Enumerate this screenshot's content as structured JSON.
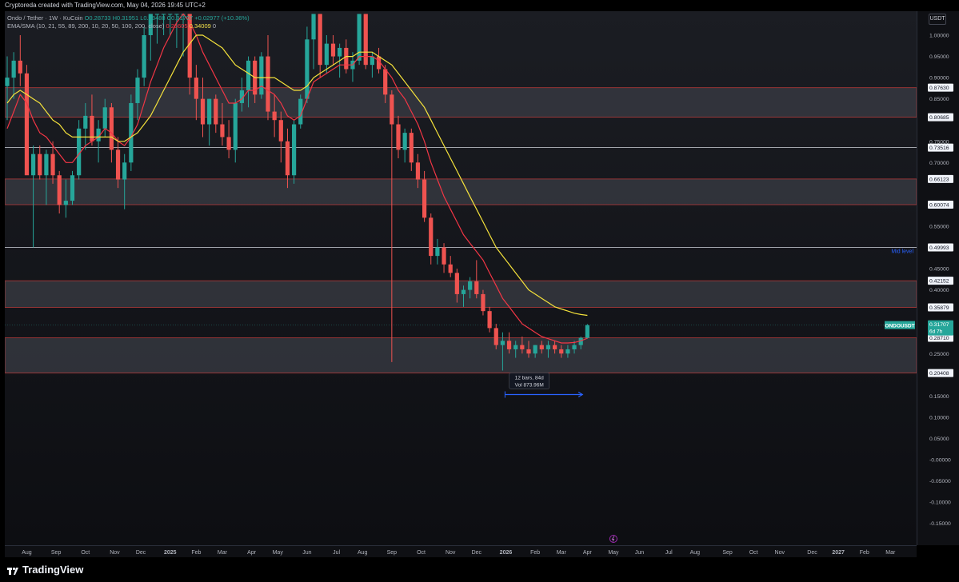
{
  "header": {
    "caption": "Cryptoreda created with TradingView.com, May 04, 2026 19:45 UTC+2"
  },
  "legend": {
    "symbol": "Ondo / Tether · 1W · KuCoin",
    "ohlc": "O0.28733  H0.31951  L0.28488  C0.31707  +0.02977 (+10.36%)",
    "indicator_name": "EMA/SMA (10, 21, 55, 89, 200, 10, 20, 50, 100, 200, close)",
    "ma_red_value": "0.28605",
    "ma_yellow_value": "0.34009",
    "tail": "0"
  },
  "price_axis": {
    "unit_button": "USDT",
    "ticks": [
      {
        "price": 1.0,
        "label": "1.00000"
      },
      {
        "price": 0.95,
        "label": "0.95000"
      },
      {
        "price": 0.9,
        "label": "0.90000"
      },
      {
        "price": 0.85,
        "label": "0.85000"
      },
      {
        "price": 0.75,
        "label": "0.75000"
      },
      {
        "price": 0.7,
        "label": "0.70000"
      },
      {
        "price": 0.55,
        "label": "0.55000"
      },
      {
        "price": 0.45,
        "label": "0.45000"
      },
      {
        "price": 0.4,
        "label": "0.40000"
      },
      {
        "price": 0.25,
        "label": "0.25000"
      },
      {
        "price": 0.15,
        "label": "0.15000"
      },
      {
        "price": 0.1,
        "label": "0.10000"
      },
      {
        "price": 0.05,
        "label": "0.05000"
      },
      {
        "price": 0.0,
        "label": "-0.00000"
      },
      {
        "price": -0.05,
        "label": "-0.05000"
      },
      {
        "price": -0.1,
        "label": "-0.10000"
      },
      {
        "price": -0.15,
        "label": "-0.15000"
      }
    ],
    "level_labels": [
      {
        "price": 0.8763,
        "label": "0.87630"
      },
      {
        "price": 0.80685,
        "label": "0.80685"
      },
      {
        "price": 0.73516,
        "label": "0.73516"
      },
      {
        "price": 0.66123,
        "label": "0.66123"
      },
      {
        "price": 0.60074,
        "label": "0.60074"
      },
      {
        "price": 0.49993,
        "label": "0.49993"
      },
      {
        "price": 0.42152,
        "label": "0.42152"
      },
      {
        "price": 0.35879,
        "label": "0.35879"
      },
      {
        "price": 0.2871,
        "label": "0.28710"
      },
      {
        "price": 0.20408,
        "label": "0.20408"
      }
    ],
    "current_price": {
      "price": 0.31707,
      "label": "0.31707",
      "countdown": "6d 7h",
      "symbol_tag": "ONDOUSDT"
    }
  },
  "chart_data": {
    "type": "candlestick",
    "symbol": "ONDOUSDT",
    "timeframe": "1W",
    "exchange": "KuCoin",
    "ylim": [
      -0.18,
      1.06
    ],
    "candles": [
      {
        "o": 0.88,
        "h": 0.95,
        "l": 0.8,
        "c": 0.9
      },
      {
        "o": 0.9,
        "h": 0.96,
        "l": 0.85,
        "c": 0.94
      },
      {
        "o": 0.94,
        "h": 1.0,
        "l": 0.88,
        "c": 0.91
      },
      {
        "o": 0.91,
        "h": 0.93,
        "l": 0.75,
        "c": 0.67
      },
      {
        "o": 0.67,
        "h": 0.74,
        "l": 0.5,
        "c": 0.72
      },
      {
        "o": 0.72,
        "h": 0.74,
        "l": 0.66,
        "c": 0.67
      },
      {
        "o": 0.67,
        "h": 0.73,
        "l": 0.6,
        "c": 0.72
      },
      {
        "o": 0.72,
        "h": 0.75,
        "l": 0.65,
        "c": 0.67
      },
      {
        "o": 0.67,
        "h": 0.68,
        "l": 0.58,
        "c": 0.6
      },
      {
        "o": 0.6,
        "h": 0.66,
        "l": 0.57,
        "c": 0.61
      },
      {
        "o": 0.61,
        "h": 0.68,
        "l": 0.6,
        "c": 0.67
      },
      {
        "o": 0.67,
        "h": 0.8,
        "l": 0.66,
        "c": 0.78
      },
      {
        "o": 0.78,
        "h": 0.84,
        "l": 0.73,
        "c": 0.81
      },
      {
        "o": 0.81,
        "h": 0.86,
        "l": 0.74,
        "c": 0.75
      },
      {
        "o": 0.75,
        "h": 0.8,
        "l": 0.7,
        "c": 0.78
      },
      {
        "o": 0.78,
        "h": 0.85,
        "l": 0.76,
        "c": 0.83
      },
      {
        "o": 0.83,
        "h": 0.84,
        "l": 0.7,
        "c": 0.73
      },
      {
        "o": 0.73,
        "h": 0.76,
        "l": 0.64,
        "c": 0.66
      },
      {
        "o": 0.66,
        "h": 0.72,
        "l": 0.59,
        "c": 0.7
      },
      {
        "o": 0.7,
        "h": 0.86,
        "l": 0.68,
        "c": 0.84
      },
      {
        "o": 0.84,
        "h": 0.92,
        "l": 0.8,
        "c": 0.9
      },
      {
        "o": 0.9,
        "h": 1.02,
        "l": 0.88,
        "c": 1.0
      },
      {
        "o": 1.0,
        "h": 1.05,
        "l": 0.94,
        "c": 1.05
      },
      {
        "o": 1.05,
        "h": 1.05,
        "l": 0.98,
        "c": 1.05
      },
      {
        "o": 1.05,
        "h": 1.05,
        "l": 1.0,
        "c": 1.05
      },
      {
        "o": 1.05,
        "h": 1.05,
        "l": 1.0,
        "c": 1.05
      },
      {
        "o": 1.05,
        "h": 1.05,
        "l": 0.97,
        "c": 1.05
      },
      {
        "o": 1.05,
        "h": 1.05,
        "l": 0.95,
        "c": 1.05
      },
      {
        "o": 1.05,
        "h": 1.05,
        "l": 0.86,
        "c": 0.9
      },
      {
        "o": 0.9,
        "h": 0.93,
        "l": 0.8,
        "c": 0.85
      },
      {
        "o": 0.85,
        "h": 0.9,
        "l": 0.76,
        "c": 0.79
      },
      {
        "o": 0.79,
        "h": 0.85,
        "l": 0.74,
        "c": 0.85
      },
      {
        "o": 0.85,
        "h": 0.86,
        "l": 0.77,
        "c": 0.79
      },
      {
        "o": 0.79,
        "h": 0.84,
        "l": 0.74,
        "c": 0.76
      },
      {
        "o": 0.76,
        "h": 0.8,
        "l": 0.71,
        "c": 0.73
      },
      {
        "o": 0.73,
        "h": 0.85,
        "l": 0.7,
        "c": 0.84
      },
      {
        "o": 0.84,
        "h": 0.9,
        "l": 0.82,
        "c": 0.87
      },
      {
        "o": 0.87,
        "h": 0.95,
        "l": 0.83,
        "c": 0.94
      },
      {
        "o": 0.94,
        "h": 0.95,
        "l": 0.84,
        "c": 0.86
      },
      {
        "o": 0.86,
        "h": 0.96,
        "l": 0.85,
        "c": 0.95
      },
      {
        "o": 0.95,
        "h": 1.0,
        "l": 0.8,
        "c": 0.82
      },
      {
        "o": 0.82,
        "h": 0.86,
        "l": 0.76,
        "c": 0.8
      },
      {
        "o": 0.8,
        "h": 0.82,
        "l": 0.7,
        "c": 0.75
      },
      {
        "o": 0.75,
        "h": 0.78,
        "l": 0.64,
        "c": 0.67
      },
      {
        "o": 0.67,
        "h": 0.8,
        "l": 0.65,
        "c": 0.79
      },
      {
        "o": 0.79,
        "h": 0.86,
        "l": 0.78,
        "c": 0.85
      },
      {
        "o": 0.85,
        "h": 1.02,
        "l": 0.84,
        "c": 0.99
      },
      {
        "o": 0.99,
        "h": 1.05,
        "l": 0.92,
        "c": 1.05
      },
      {
        "o": 1.05,
        "h": 1.05,
        "l": 0.9,
        "c": 0.93
      },
      {
        "o": 0.93,
        "h": 1.0,
        "l": 0.91,
        "c": 0.98
      },
      {
        "o": 0.98,
        "h": 1.0,
        "l": 0.93,
        "c": 0.95
      },
      {
        "o": 0.95,
        "h": 0.98,
        "l": 0.9,
        "c": 0.97
      },
      {
        "o": 0.97,
        "h": 0.99,
        "l": 0.91,
        "c": 0.92
      },
      {
        "o": 0.92,
        "h": 0.96,
        "l": 0.89,
        "c": 0.94
      },
      {
        "o": 0.94,
        "h": 1.05,
        "l": 0.93,
        "c": 1.05
      },
      {
        "o": 1.05,
        "h": 1.05,
        "l": 0.92,
        "c": 0.93
      },
      {
        "o": 0.93,
        "h": 0.96,
        "l": 0.9,
        "c": 0.95
      },
      {
        "o": 0.95,
        "h": 0.97,
        "l": 0.91,
        "c": 0.92
      },
      {
        "o": 0.92,
        "h": 0.93,
        "l": 0.84,
        "c": 0.86
      },
      {
        "o": 0.86,
        "h": 0.87,
        "l": 0.23,
        "c": 0.79
      },
      {
        "o": 0.79,
        "h": 0.81,
        "l": 0.71,
        "c": 0.73
      },
      {
        "o": 0.73,
        "h": 0.78,
        "l": 0.7,
        "c": 0.77
      },
      {
        "o": 0.77,
        "h": 0.78,
        "l": 0.68,
        "c": 0.7
      },
      {
        "o": 0.7,
        "h": 0.72,
        "l": 0.64,
        "c": 0.66
      },
      {
        "o": 0.66,
        "h": 0.68,
        "l": 0.56,
        "c": 0.57
      },
      {
        "o": 0.57,
        "h": 0.58,
        "l": 0.46,
        "c": 0.48
      },
      {
        "o": 0.48,
        "h": 0.52,
        "l": 0.46,
        "c": 0.5
      },
      {
        "o": 0.5,
        "h": 0.51,
        "l": 0.44,
        "c": 0.46
      },
      {
        "o": 0.46,
        "h": 0.48,
        "l": 0.43,
        "c": 0.44
      },
      {
        "o": 0.44,
        "h": 0.45,
        "l": 0.37,
        "c": 0.39
      },
      {
        "o": 0.39,
        "h": 0.41,
        "l": 0.36,
        "c": 0.4
      },
      {
        "o": 0.4,
        "h": 0.43,
        "l": 0.38,
        "c": 0.42
      },
      {
        "o": 0.42,
        "h": 0.47,
        "l": 0.38,
        "c": 0.39
      },
      {
        "o": 0.39,
        "h": 0.4,
        "l": 0.34,
        "c": 0.35
      },
      {
        "o": 0.35,
        "h": 0.36,
        "l": 0.3,
        "c": 0.31
      },
      {
        "o": 0.31,
        "h": 0.32,
        "l": 0.26,
        "c": 0.27
      },
      {
        "o": 0.27,
        "h": 0.3,
        "l": 0.21,
        "c": 0.28
      },
      {
        "o": 0.28,
        "h": 0.3,
        "l": 0.25,
        "c": 0.26
      },
      {
        "o": 0.26,
        "h": 0.28,
        "l": 0.24,
        "c": 0.27
      },
      {
        "o": 0.27,
        "h": 0.29,
        "l": 0.25,
        "c": 0.26
      },
      {
        "o": 0.26,
        "h": 0.28,
        "l": 0.24,
        "c": 0.25
      },
      {
        "o": 0.25,
        "h": 0.27,
        "l": 0.24,
        "c": 0.27
      },
      {
        "o": 0.27,
        "h": 0.28,
        "l": 0.25,
        "c": 0.26
      },
      {
        "o": 0.26,
        "h": 0.28,
        "l": 0.24,
        "c": 0.27
      },
      {
        "o": 0.27,
        "h": 0.28,
        "l": 0.25,
        "c": 0.26
      },
      {
        "o": 0.26,
        "h": 0.27,
        "l": 0.24,
        "c": 0.25
      },
      {
        "o": 0.25,
        "h": 0.27,
        "l": 0.24,
        "c": 0.26
      },
      {
        "o": 0.26,
        "h": 0.28,
        "l": 0.25,
        "c": 0.27
      },
      {
        "o": 0.27,
        "h": 0.29,
        "l": 0.26,
        "c": 0.287
      },
      {
        "o": 0.287,
        "h": 0.3195,
        "l": 0.2849,
        "c": 0.317
      }
    ],
    "ema_red": [
      0.78,
      0.82,
      0.86,
      0.84,
      0.8,
      0.77,
      0.76,
      0.74,
      0.72,
      0.7,
      0.7,
      0.72,
      0.74,
      0.75,
      0.76,
      0.78,
      0.77,
      0.75,
      0.74,
      0.76,
      0.79,
      0.84,
      0.89,
      0.93,
      0.97,
      1.0,
      1.03,
      1.05,
      1.03,
      1.0,
      0.96,
      0.93,
      0.9,
      0.87,
      0.84,
      0.84,
      0.85,
      0.87,
      0.87,
      0.88,
      0.87,
      0.86,
      0.84,
      0.81,
      0.8,
      0.81,
      0.85,
      0.89,
      0.9,
      0.91,
      0.92,
      0.93,
      0.93,
      0.93,
      0.95,
      0.95,
      0.95,
      0.94,
      0.92,
      0.9,
      0.87,
      0.85,
      0.82,
      0.79,
      0.75,
      0.7,
      0.66,
      0.62,
      0.59,
      0.56,
      0.53,
      0.51,
      0.49,
      0.47,
      0.44,
      0.41,
      0.38,
      0.36,
      0.34,
      0.32,
      0.31,
      0.3,
      0.29,
      0.285,
      0.28,
      0.275,
      0.275,
      0.276,
      0.28,
      0.286
    ],
    "sma_yellow": [
      0.84,
      0.86,
      0.87,
      0.86,
      0.85,
      0.84,
      0.82,
      0.8,
      0.79,
      0.77,
      0.76,
      0.76,
      0.76,
      0.76,
      0.76,
      0.76,
      0.76,
      0.75,
      0.75,
      0.76,
      0.77,
      0.79,
      0.81,
      0.84,
      0.87,
      0.9,
      0.93,
      0.96,
      0.98,
      1.0,
      1.0,
      0.99,
      0.98,
      0.97,
      0.95,
      0.93,
      0.92,
      0.91,
      0.9,
      0.9,
      0.9,
      0.9,
      0.89,
      0.88,
      0.87,
      0.87,
      0.88,
      0.9,
      0.91,
      0.92,
      0.93,
      0.94,
      0.95,
      0.95,
      0.96,
      0.96,
      0.96,
      0.95,
      0.94,
      0.93,
      0.91,
      0.89,
      0.87,
      0.85,
      0.83,
      0.8,
      0.77,
      0.74,
      0.71,
      0.68,
      0.65,
      0.62,
      0.59,
      0.56,
      0.53,
      0.5,
      0.48,
      0.46,
      0.44,
      0.42,
      0.4,
      0.39,
      0.38,
      0.37,
      0.36,
      0.355,
      0.35,
      0.345,
      0.342,
      0.34
    ],
    "zones": [
      {
        "top": 0.8763,
        "bottom": 0.80685
      },
      {
        "top": 0.66123,
        "bottom": 0.60074
      },
      {
        "top": 0.42152,
        "bottom": 0.35879
      },
      {
        "top": 0.2871,
        "bottom": 0.20408
      }
    ],
    "lines": [
      {
        "price": 0.73516
      },
      {
        "price": 0.49993,
        "label": "Mid level"
      }
    ],
    "measure": {
      "from_index": 76,
      "to_index": 88,
      "text_bars": "12 bars, 84d",
      "text_vol": "Vol 873.96M"
    },
    "x_labels": [
      {
        "index": 3,
        "label": "Aug"
      },
      {
        "index": 7.5,
        "label": "Sep"
      },
      {
        "index": 12,
        "label": "Oct"
      },
      {
        "index": 16.5,
        "label": "Nov"
      },
      {
        "index": 20.5,
        "label": "Dec"
      },
      {
        "index": 25,
        "label": "2025"
      },
      {
        "index": 29,
        "label": "Feb"
      },
      {
        "index": 33,
        "label": "Mar"
      },
      {
        "index": 37.5,
        "label": "Apr"
      },
      {
        "index": 41.5,
        "label": "May"
      },
      {
        "index": 46,
        "label": "Jun"
      },
      {
        "index": 50.5,
        "label": "Jul"
      },
      {
        "index": 54.5,
        "label": "Aug"
      },
      {
        "index": 59,
        "label": "Sep"
      },
      {
        "index": 63.5,
        "label": "Oct"
      },
      {
        "index": 68,
        "label": "Nov"
      },
      {
        "index": 72,
        "label": "Dec"
      },
      {
        "index": 76.5,
        "label": "2026"
      },
      {
        "index": 81,
        "label": "Feb"
      },
      {
        "index": 85,
        "label": "Mar"
      },
      {
        "index": 89,
        "label": "Apr"
      },
      {
        "index": 93,
        "label": "May"
      },
      {
        "index": 97,
        "label": "Jun"
      },
      {
        "index": 101.5,
        "label": "Jul"
      },
      {
        "index": 105.5,
        "label": "Aug"
      },
      {
        "index": 110.5,
        "label": "Sep"
      },
      {
        "index": 114.5,
        "label": "Oct"
      },
      {
        "index": 118.5,
        "label": "Nov"
      },
      {
        "index": 123.5,
        "label": "Dec"
      },
      {
        "index": 127.5,
        "label": "2027"
      },
      {
        "index": 131.5,
        "label": "Feb"
      },
      {
        "index": 135.5,
        "label": "Mar"
      }
    ]
  },
  "colors": {
    "up": "#26a69a",
    "down": "#ef5350",
    "ema_red": "#f23645",
    "sma_yellow": "#f5e23b",
    "zone_fill": "#3a3c44",
    "zone_border": "#b23a3a",
    "measure": "#2962ff"
  },
  "footer": {
    "brand": "TradingView"
  }
}
